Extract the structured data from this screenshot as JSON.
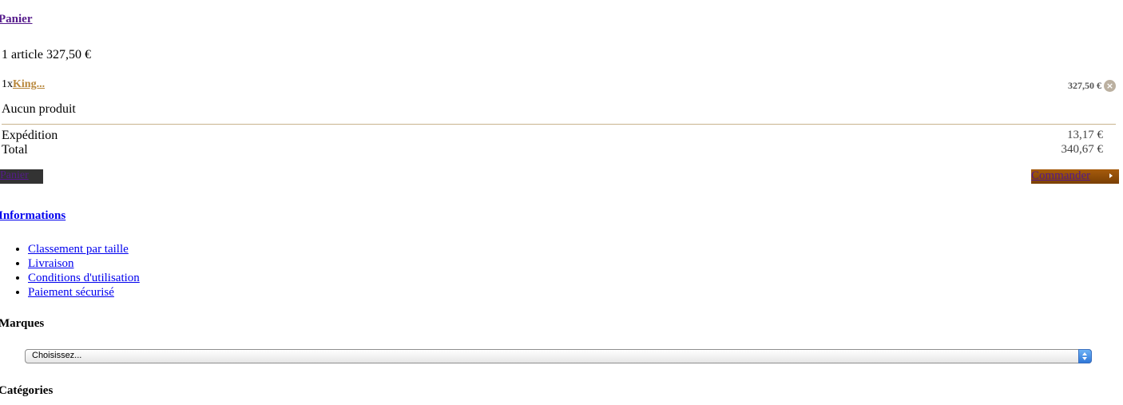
{
  "cart": {
    "title": "Panier",
    "summary": "1 article 327,50 €",
    "items": [
      {
        "qty": "1x",
        "name": "King...",
        "price": "327,50 €",
        "remove_icon": "remove-circle-icon"
      }
    ],
    "empty_text": "Aucun produit",
    "shipping_label": "Expédition",
    "shipping_value": "13,17 €",
    "total_label": "Total",
    "total_value": "340,67 €",
    "view_cart_label": "Panier",
    "order_label": "Commander",
    "order_icon": "arrow-right-icon",
    "colors": {
      "divider": "#c8b48e",
      "order_button": "#a65b0c",
      "cart_button": "#333333",
      "product_link": "#b8873b"
    }
  },
  "informations": {
    "title": "Informations",
    "links": [
      "Classement par taille",
      "Livraison",
      "Conditions d'utilisation",
      "Paiement sécurisé"
    ]
  },
  "brands": {
    "title": "Marques",
    "selected": "Choisissez..."
  },
  "categories": {
    "title": "Catégories"
  }
}
